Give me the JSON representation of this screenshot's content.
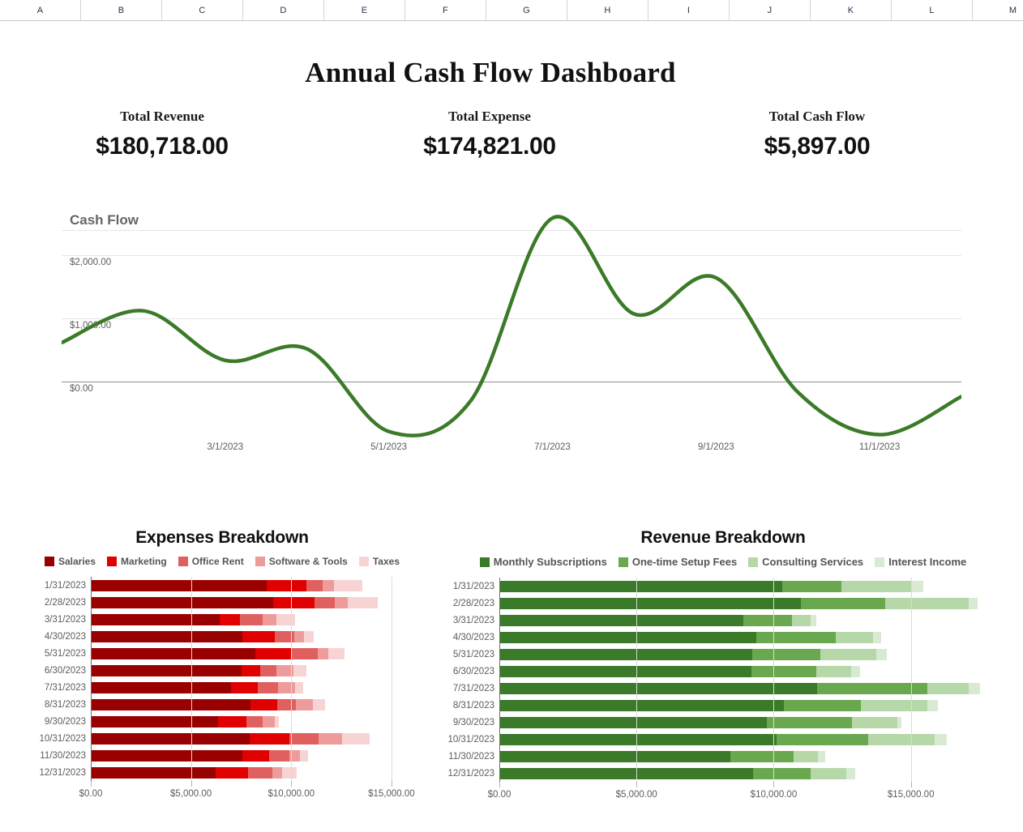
{
  "spreadsheet": {
    "columns": [
      "A",
      "B",
      "C",
      "D",
      "E",
      "F",
      "G",
      "H",
      "I",
      "J",
      "K",
      "L",
      "M"
    ]
  },
  "dashboard": {
    "title": "Annual Cash Flow Dashboard",
    "kpis": [
      {
        "label": "Total Revenue",
        "value": "$180,718.00"
      },
      {
        "label": "Total Expense",
        "value": "$174,821.00"
      },
      {
        "label": "Total Cash Flow",
        "value": "$5,897.00"
      }
    ]
  },
  "chart_data": [
    {
      "type": "line",
      "title": "Cash Flow",
      "xlabel": "",
      "ylabel": "",
      "grid": true,
      "legend": "none",
      "line_color": "#3b7a28",
      "ytick_labels": [
        "$0.00",
        "$1,000.00",
        "$2,000.00"
      ],
      "yticks": [
        0,
        1000,
        2000
      ],
      "ylim": [
        -900,
        2800
      ],
      "xtick_labels": [
        "3/1/2023",
        "5/1/2023",
        "7/1/2023",
        "9/1/2023",
        "11/1/2023"
      ],
      "x": [
        "1/31/2023",
        "2/28/2023",
        "3/31/2023",
        "4/30/2023",
        "5/31/2023",
        "6/30/2023",
        "7/31/2023",
        "8/31/2023",
        "9/30/2023",
        "10/31/2023",
        "11/30/2023",
        "12/31/2023"
      ],
      "values": [
        620,
        1120,
        340,
        520,
        -780,
        -300,
        2580,
        1070,
        1640,
        -160,
        -830,
        -230
      ]
    },
    {
      "type": "bar",
      "orientation": "horizontal",
      "stacked": true,
      "title": "Expenses Breakdown",
      "xlabel": "",
      "ylabel": "",
      "grid": true,
      "legend": "top",
      "xtick_labels": [
        "$0.00",
        "$5,000.00",
        "$10,000.00",
        "$15,000.00"
      ],
      "xticks": [
        0,
        5000,
        10000,
        15000
      ],
      "xlim": [
        0,
        16500
      ],
      "categories": [
        "1/31/2023",
        "2/28/2023",
        "3/31/2023",
        "4/30/2023",
        "5/31/2023",
        "6/30/2023",
        "7/31/2023",
        "8/31/2023",
        "9/30/2023",
        "10/31/2023",
        "11/30/2023",
        "12/31/2023"
      ],
      "series": [
        {
          "name": "Salaries",
          "color": "#990000",
          "values": [
            8760,
            9080,
            6450,
            7550,
            8190,
            7530,
            7000,
            7960,
            6350,
            7940,
            7560,
            6210
          ]
        },
        {
          "name": "Marketing",
          "color": "#e00000",
          "values": [
            1990,
            2090,
            990,
            1640,
            1780,
            910,
            1330,
            1330,
            1420,
            1970,
            1340,
            1650
          ]
        },
        {
          "name": "Office Rent",
          "color": "#e06060",
          "values": [
            820,
            990,
            1130,
            970,
            1350,
            840,
            1020,
            950,
            800,
            1440,
            1010,
            1180
          ]
        },
        {
          "name": "Software & Tools",
          "color": "#ee9b9b",
          "values": [
            560,
            680,
            700,
            470,
            540,
            820,
            850,
            860,
            620,
            1190,
            530,
            500
          ]
        },
        {
          "name": "Taxes",
          "color": "#f8d3d3",
          "values": [
            1400,
            1490,
            940,
            480,
            800,
            640,
            400,
            580,
            190,
            1370,
            390,
            720
          ]
        }
      ]
    },
    {
      "type": "bar",
      "orientation": "horizontal",
      "stacked": true,
      "title": "Revenue Breakdown",
      "xlabel": "",
      "ylabel": "",
      "grid": true,
      "legend": "top",
      "xtick_labels": [
        "$0.00",
        "$5,000.00",
        "$10,000.00",
        "$15,000.00"
      ],
      "xticks": [
        0,
        5000,
        10000,
        15000
      ],
      "xlim": [
        0,
        18200
      ],
      "categories": [
        "1/31/2023",
        "2/28/2023",
        "3/31/2023",
        "4/30/2023",
        "5/31/2023",
        "6/30/2023",
        "7/31/2023",
        "8/31/2023",
        "9/30/2023",
        "10/31/2023",
        "11/30/2023",
        "12/31/2023"
      ],
      "series": [
        {
          "name": "Monthly Subscriptions",
          "color": "#3a7a28",
          "values": [
            10300,
            11000,
            8890,
            9370,
            9210,
            9190,
            11570,
            10380,
            9760,
            10110,
            8430,
            9240
          ]
        },
        {
          "name": "One-time Setup Fees",
          "color": "#6aa84f",
          "values": [
            2180,
            3050,
            1790,
            2900,
            2480,
            2350,
            4020,
            2790,
            3080,
            3340,
            2290,
            2120
          ]
        },
        {
          "name": "Consulting Services",
          "color": "#b6d7a8",
          "values": [
            2520,
            3060,
            670,
            1360,
            2050,
            1280,
            1520,
            2420,
            1660,
            2420,
            880,
            1290
          ]
        },
        {
          "name": "Interest Income",
          "color": "#d9ead3",
          "values": [
            450,
            310,
            200,
            290,
            380,
            330,
            400,
            390,
            160,
            440,
            290,
            330
          ]
        }
      ]
    }
  ]
}
